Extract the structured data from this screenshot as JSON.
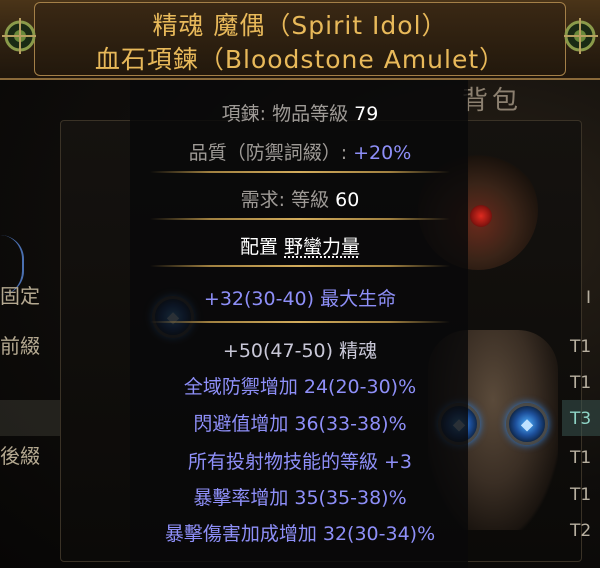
{
  "item": {
    "name_line1": "精魂 魔偶（Spirit Idol）",
    "name_line2": "血石項鍊（Bloodstone Amulet）",
    "item_class_label": "項鍊:",
    "item_level_label": "物品等級",
    "item_level_value": "79",
    "quality_label": "品質（防禦詞綴）:",
    "quality_value": "+20%",
    "requirement_label": "需求:",
    "requirement_level_label": "等級",
    "requirement_level_value": "60",
    "allocation_label": "配置",
    "allocation_value": "野蠻力量",
    "implicit": "+32(30-40) 最大生命",
    "explicit_mods": [
      "+50(47-50) 精魂",
      "全域防禦增加 24(20-30)%",
      "閃避值增加 36(33-38)%",
      "所有投射物技能的等級 +3",
      "暴擊率增加 35(35-38)%",
      "暴擊傷害加成增加 32(30-34)%"
    ]
  },
  "background": {
    "panel_title": "背包",
    "left_tabs": [
      "固定",
      "前綴",
      "後綴"
    ],
    "tiers": [
      "I",
      "T1",
      "T1",
      "T3",
      "T1",
      "T1",
      "T2"
    ]
  },
  "colors": {
    "item_name": "#e8b95a",
    "magic_mod": "#8e8ff8",
    "label_grey": "#9e9a96"
  }
}
